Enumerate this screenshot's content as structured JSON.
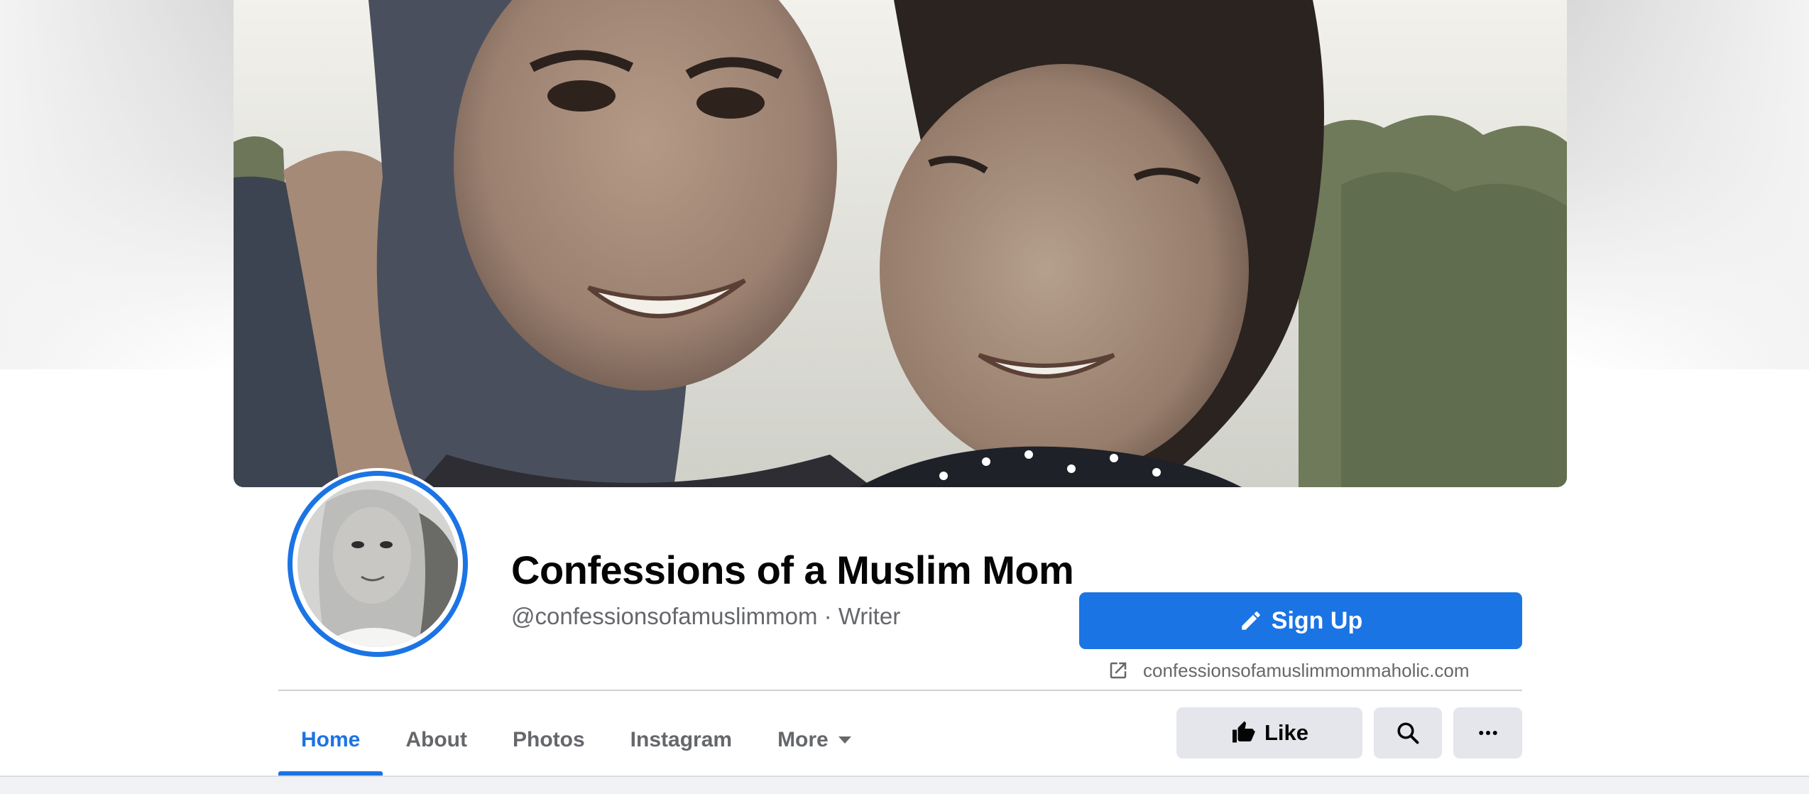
{
  "page": {
    "name": "Confessions of a Muslim Mom",
    "handle": "@confessionsofamuslimmom",
    "separator": "·",
    "category": "Writer",
    "website": "confessionsofamuslimmommaholic.com"
  },
  "actions": {
    "signup_label": "Sign Up",
    "like_label": "Like"
  },
  "tabs": [
    {
      "label": "Home",
      "active": true
    },
    {
      "label": "About",
      "active": false
    },
    {
      "label": "Photos",
      "active": false
    },
    {
      "label": "Instagram",
      "active": false
    },
    {
      "label": "More",
      "active": false
    }
  ],
  "icons": {
    "signup": "pencil-icon",
    "website": "external-link-icon",
    "like": "thumbs-up-icon",
    "search": "search-icon",
    "more": "ellipsis-icon",
    "tab_more": "caret-down-icon"
  },
  "colors": {
    "accent": "#1b74e4",
    "secondary_text": "#65676b",
    "button_gray": "#e4e6eb",
    "page_background": "#f0f2f5"
  }
}
